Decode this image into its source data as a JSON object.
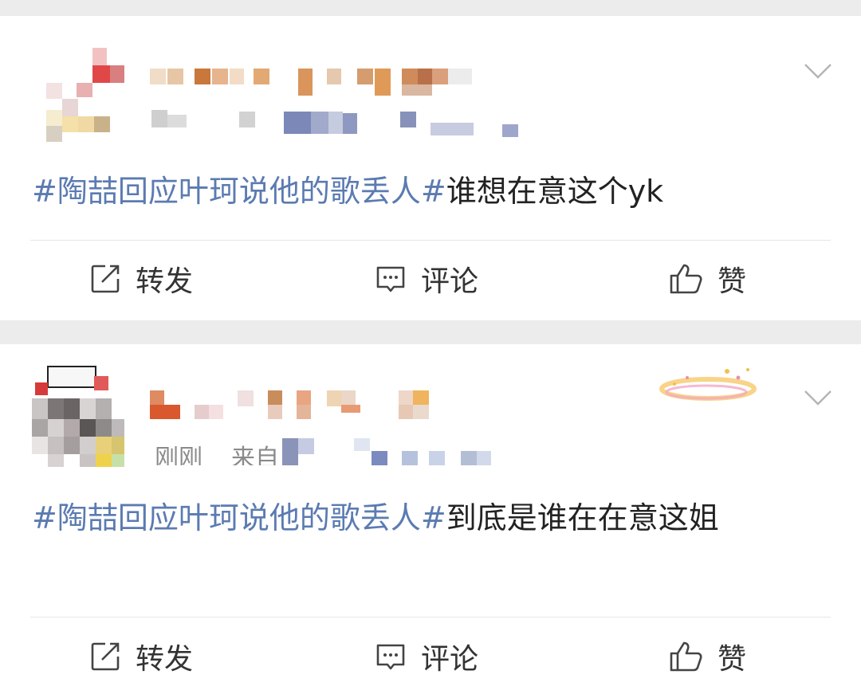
{
  "posts": [
    {
      "time": "",
      "source": "",
      "topic": "#陶喆回应叶珂说他的歌丢人#",
      "body": "谁想在意这个yk",
      "actions": {
        "repost": "转发",
        "comment": "评论",
        "like": "赞"
      }
    },
    {
      "time": "刚刚",
      "source": "来自",
      "topic": "#陶喆回应叶珂说他的歌丢人#",
      "body": "到底是谁在在意这姐",
      "actions": {
        "repost": "转发",
        "comment": "评论",
        "like": "赞"
      }
    }
  ],
  "colors": {
    "topic": "#5b7bb1",
    "text": "#222222",
    "meta": "#8a8a8a",
    "background": "#f0f0f0"
  },
  "icons": {
    "repost": "share-square-icon",
    "comment": "comment-bubble-icon",
    "like": "thumbs-up-icon",
    "menu": "chevron-down-icon"
  }
}
